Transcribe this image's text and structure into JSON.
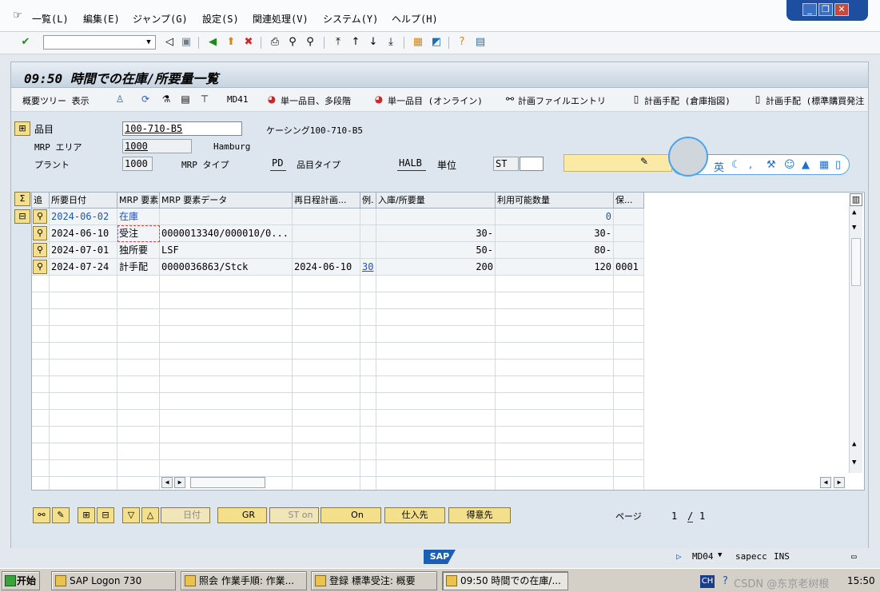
{
  "menu": [
    "一覧(L)",
    "編集(E)",
    "ジャンプ(G)",
    "設定(S)",
    "関連処理(V)",
    "システム(Y)",
    "ヘルプ(H)"
  ],
  "title": "09:50 時間での在庫/所要量一覧",
  "appbar": {
    "overview_tree": "概要ツリー 表示",
    "md41": "MD41",
    "single_multi": "単一品目、多段階",
    "single_online": "単一品目 (オンライン)",
    "plan_file": "計画ファイルエントリ",
    "plan_order_storage": "計画手配 (倉庫指図)",
    "plan_order_std": "計画手配 (標準購買発注"
  },
  "header": {
    "material_label": "品目",
    "material_value": "100-710-B5",
    "material_desc": "ケーシング100-710-B5",
    "mrp_area_label": "MRP エリア",
    "mrp_area_value": "1000",
    "mrp_area_desc": "Hamburg",
    "plant_label": "プラント",
    "plant_value": "1000",
    "mrp_type_label": "MRP タイプ",
    "mrp_type_value": "PD",
    "mat_type_label": "品目タイプ",
    "mat_type_value": "HALB",
    "unit_label": "単位",
    "unit_value": "ST"
  },
  "ime": {
    "lang": "英"
  },
  "grid": {
    "columns": [
      "追",
      "所要日付",
      "MRP 要素",
      "MRP 要素データ",
      "再日程計画...",
      "例.",
      "入庫/所要量",
      "利用可能数量",
      "保..."
    ],
    "rows": [
      {
        "date": "2024-06-02",
        "element": "在庫",
        "data": "",
        "resched": "",
        "exc": "",
        "qty": "",
        "avail": "0",
        "stor": ""
      },
      {
        "date": "2024-06-10",
        "element": "受注",
        "data": "0000013340/000010/0...",
        "resched": "",
        "exc": "",
        "qty": "30-",
        "avail": "30-",
        "stor": ""
      },
      {
        "date": "2024-07-01",
        "element": "独所要",
        "data": "LSF",
        "resched": "",
        "exc": "",
        "qty": "50-",
        "avail": "80-",
        "stor": ""
      },
      {
        "date": "2024-07-24",
        "element": "計手配",
        "data": "0000036863/Stck",
        "resched": "2024-06-10",
        "exc": "30",
        "qty": "200",
        "avail": "120",
        "stor": "0001"
      }
    ]
  },
  "buttons": {
    "date": "日付",
    "gr": "GR",
    "st_on": "ST on",
    "on": "On",
    "vendor": "仕入先",
    "customer": "得意先"
  },
  "pager": {
    "label": "ページ",
    "current": "1",
    "total": "1"
  },
  "status": {
    "tcode": "MD04",
    "system": "sapecc",
    "mode": "INS"
  },
  "taskbar": {
    "start": "开始",
    "items": [
      "SAP Logon 730",
      "照会 作業手順: 作業...",
      "登録 標準受注: 概要",
      "09:50 時間での在庫/..."
    ],
    "lang": "CH",
    "clock": "15:50",
    "watermark": "CSDN @东京老树根"
  }
}
